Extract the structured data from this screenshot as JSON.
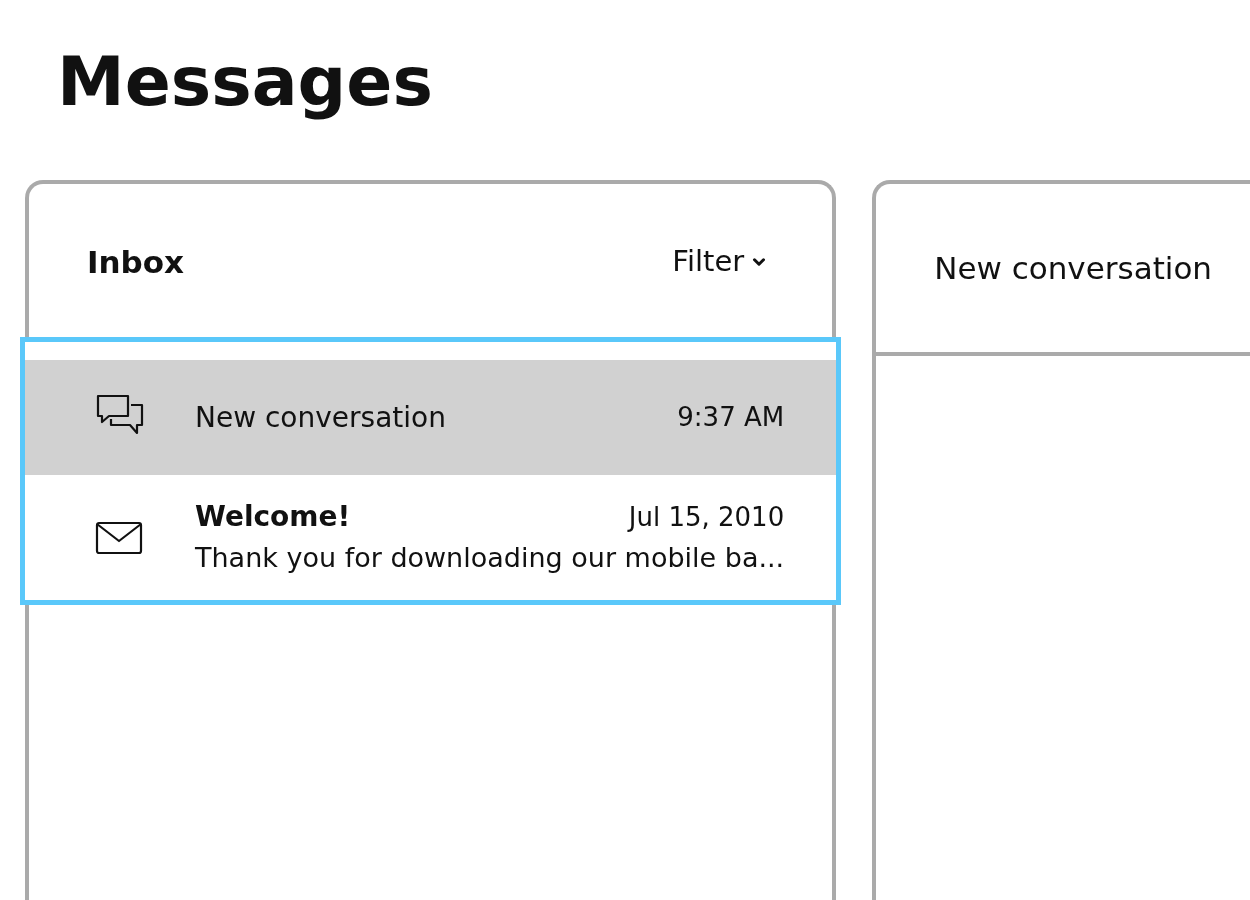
{
  "title": "Messages",
  "inbox": {
    "title": "Inbox",
    "filter": "Filter",
    "list_highlighted": true,
    "messages": [
      {
        "kind": "conversation",
        "subject": "New conversation",
        "time": "9:37 AM",
        "selected": true
      },
      {
        "kind": "mail",
        "subject": "Welcome!",
        "time": "Jul 15, 2010",
        "preview": "Thank you for downloading our mobile ba...",
        "selected": false
      }
    ]
  },
  "detail": {
    "title": "New conversation"
  }
}
